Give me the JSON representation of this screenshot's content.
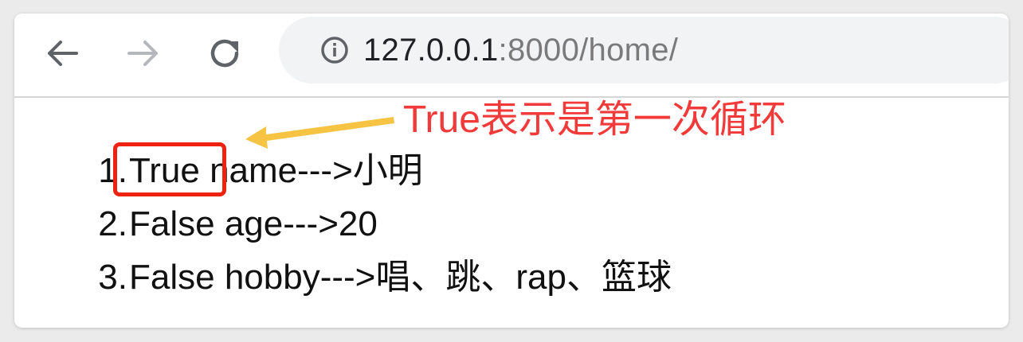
{
  "browser": {
    "url_host": "127.0.0.1",
    "url_rest": ":8000/home/",
    "icons": {
      "back": "arrow-left-icon",
      "forward": "arrow-right-icon",
      "reload": "reload-icon",
      "site_info": "info-icon"
    }
  },
  "annotation": {
    "text": "True表示是第一次循环",
    "color": "#f23a3a",
    "arrow_color": "#f6c343",
    "box_color": "#ee2211"
  },
  "list": [
    {
      "number": "1.",
      "text": "True name--->小明"
    },
    {
      "number": "2.",
      "text": "False age--->20"
    },
    {
      "number": "3.",
      "text": "False hobby--->唱、跳、rap、篮球"
    }
  ]
}
